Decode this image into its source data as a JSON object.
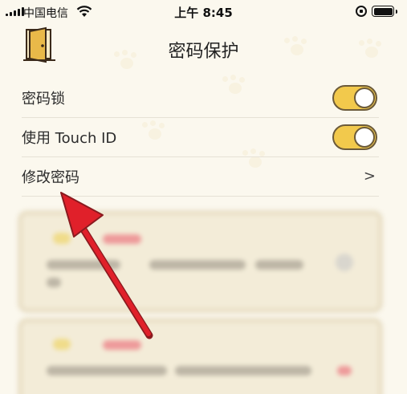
{
  "status_bar": {
    "carrier": "中国电信",
    "time": "上午 8:45"
  },
  "header": {
    "title": "密码保护"
  },
  "settings": [
    {
      "label": "密码锁",
      "control": "toggle",
      "enabled": true
    },
    {
      "label": "使用 Touch ID",
      "control": "toggle",
      "enabled": true
    },
    {
      "label": "修改密码",
      "control": "chevron",
      "chevron_glyph": ">"
    }
  ],
  "colors": {
    "toggle_on": "#f2c94c",
    "annotation_arrow": "#e0202a",
    "background": "#fbf8ee"
  },
  "icons": [
    "signal-icon",
    "wifi-icon",
    "rotation-lock-icon",
    "battery-icon",
    "door-icon",
    "chevron-right-icon"
  ]
}
